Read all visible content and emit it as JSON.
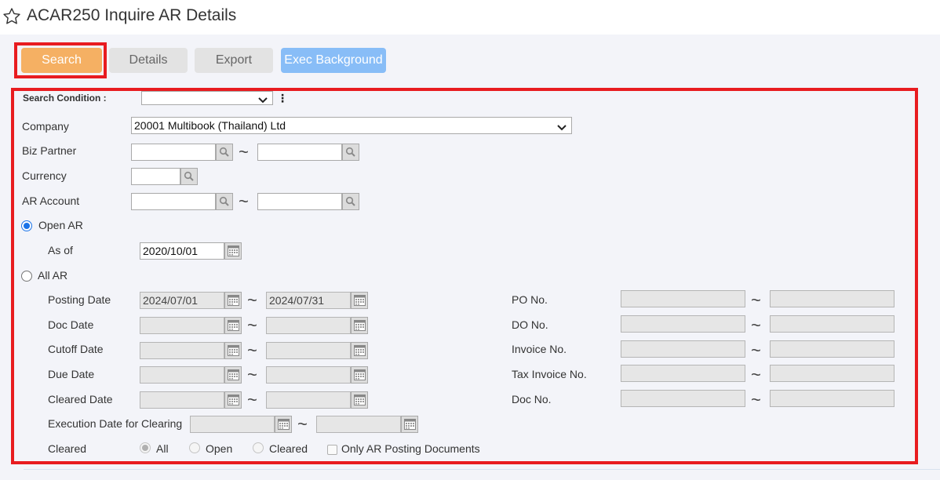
{
  "page": {
    "title": "ACAR250 Inquire AR Details"
  },
  "toolbar": {
    "search": "Search",
    "details": "Details",
    "export": "Export",
    "exec_background": "Exec Background"
  },
  "form": {
    "search_condition": {
      "label": "Search Condition :",
      "value": ""
    },
    "company": {
      "label": "Company",
      "value": "20001 Multibook (Thailand) Ltd"
    },
    "biz_partner": {
      "label": "Biz Partner",
      "from": "",
      "to": ""
    },
    "currency": {
      "label": "Currency",
      "value": ""
    },
    "ar_account": {
      "label": "AR Account",
      "from": "",
      "to": ""
    },
    "open_ar": {
      "label": "Open AR",
      "selected": true
    },
    "as_of": {
      "label": "As of",
      "value": "2020/10/01"
    },
    "all_ar": {
      "label": "All AR",
      "selected": false
    },
    "posting_date": {
      "label": "Posting Date",
      "from": "2024/07/01",
      "to": "2024/07/31"
    },
    "doc_date": {
      "label": "Doc Date",
      "from": "",
      "to": ""
    },
    "cutoff_date": {
      "label": "Cutoff Date",
      "from": "",
      "to": ""
    },
    "due_date": {
      "label": "Due Date",
      "from": "",
      "to": ""
    },
    "cleared_date": {
      "label": "Cleared Date",
      "from": "",
      "to": ""
    },
    "execution_date_for_clearing": {
      "label": "Execution Date for Clearing",
      "from": "",
      "to": ""
    },
    "po_no": {
      "label": "PO No.",
      "from": "",
      "to": ""
    },
    "do_no": {
      "label": "DO No.",
      "from": "",
      "to": ""
    },
    "invoice_no": {
      "label": "Invoice No.",
      "from": "",
      "to": ""
    },
    "tax_invoice_no": {
      "label": "Tax Invoice No.",
      "from": "",
      "to": ""
    },
    "doc_no": {
      "label": "Doc No.",
      "from": "",
      "to": ""
    },
    "cleared": {
      "label": "Cleared",
      "options": [
        "All",
        "Open",
        "Cleared"
      ],
      "selected": "All",
      "only_ar_posting": "Only AR Posting Documents"
    },
    "range_separator": "~"
  },
  "colors": {
    "search_button": "#f5b063",
    "exec_button": "#88bdf7",
    "highlight": "#e81c20",
    "radio_selected": "#1a73e8"
  }
}
